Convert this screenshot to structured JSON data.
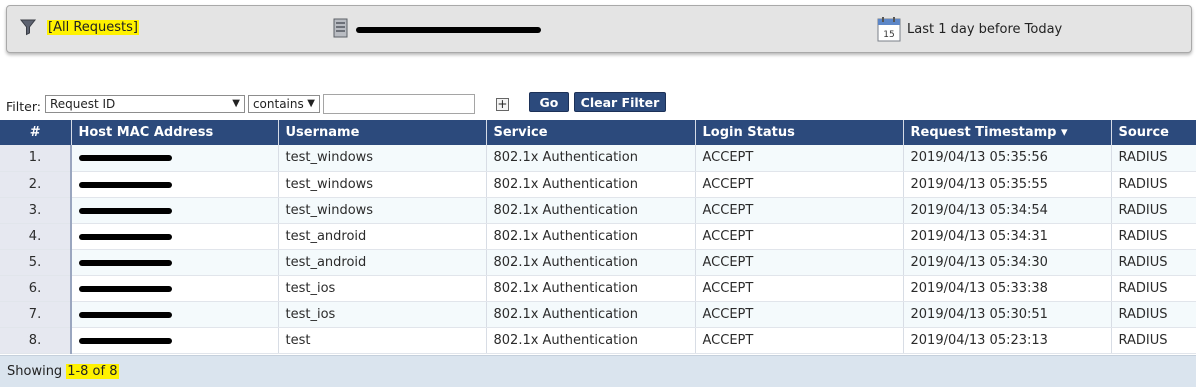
{
  "summary": {
    "filter_name": "[All Requests]",
    "time_range": "Last 1 day before Today",
    "calendar_day": "15"
  },
  "filter": {
    "label": "Filter:",
    "field": "Request ID",
    "operator": "contains",
    "value": "",
    "go_label": "Go",
    "clear_label": "Clear Filter",
    "add_label": "+"
  },
  "table": {
    "columns": [
      "#",
      "Host MAC Address",
      "Username",
      "Service",
      "Login Status",
      "Request Timestamp ▾",
      "Source"
    ],
    "rows": [
      {
        "num": "1.",
        "username": "test_windows",
        "service": "802.1x Authentication",
        "status": "ACCEPT",
        "timestamp": "2019/04/13 05:35:56",
        "source": "RADIUS"
      },
      {
        "num": "2.",
        "username": "test_windows",
        "service": "802.1x Authentication",
        "status": "ACCEPT",
        "timestamp": "2019/04/13 05:35:55",
        "source": "RADIUS"
      },
      {
        "num": "3.",
        "username": "test_windows",
        "service": "802.1x Authentication",
        "status": "ACCEPT",
        "timestamp": "2019/04/13 05:34:54",
        "source": "RADIUS"
      },
      {
        "num": "4.",
        "username": "test_android",
        "service": "802.1x Authentication",
        "status": "ACCEPT",
        "timestamp": "2019/04/13 05:34:31",
        "source": "RADIUS"
      },
      {
        "num": "5.",
        "username": "test_android",
        "service": "802.1x Authentication",
        "status": "ACCEPT",
        "timestamp": "2019/04/13 05:34:30",
        "source": "RADIUS"
      },
      {
        "num": "6.",
        "username": "test_ios",
        "service": "802.1x Authentication",
        "status": "ACCEPT",
        "timestamp": "2019/04/13 05:33:38",
        "source": "RADIUS"
      },
      {
        "num": "7.",
        "username": "test_ios",
        "service": "802.1x Authentication",
        "status": "ACCEPT",
        "timestamp": "2019/04/13 05:30:51",
        "source": "RADIUS"
      },
      {
        "num": "8.",
        "username": "test",
        "service": "802.1x Authentication",
        "status": "ACCEPT",
        "timestamp": "2019/04/13 05:23:13",
        "source": "RADIUS"
      }
    ]
  },
  "footer": {
    "showing_label": "Showing",
    "range": "1-8 of 8"
  },
  "colors": {
    "header": "#2c4a7c",
    "highlight": "#fff200",
    "footer": "#dae4ee"
  }
}
